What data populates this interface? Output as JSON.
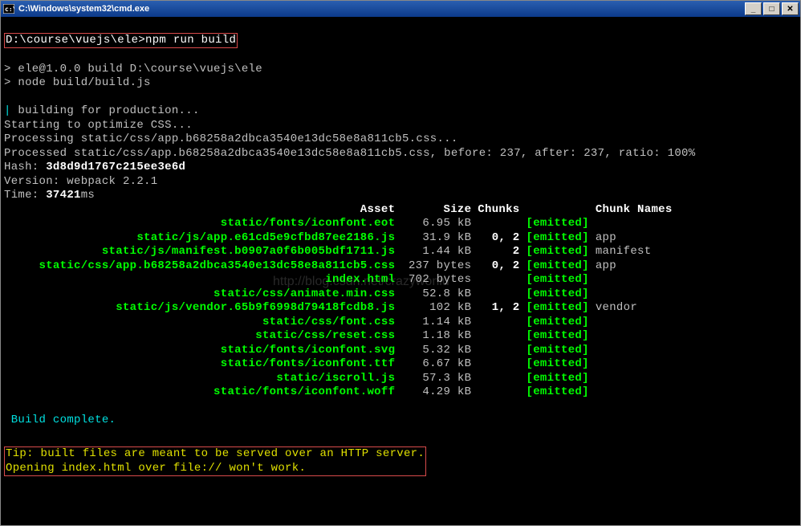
{
  "title": "C:\\Windows\\system32\\cmd.exe",
  "prompt": {
    "path": "D:\\course\\vuejs\\ele>",
    "cmd": "npm run build"
  },
  "npm_lines": [
    "> ele@1.0.0 build D:\\course\\vuejs\\ele",
    "> node build/build.js"
  ],
  "build": {
    "pipe": "|",
    "building": "building for production...",
    "optimize": "Starting to optimize CSS...",
    "processing": "Processing static/css/app.b68258a2dbca3540e13dc58e8a811cb5.css...",
    "processed_prefix": "Processed static/css/app.b68258a2dbca3540e13dc58e8a811cb5.css, before: 237, after: 237, ratio: 100%",
    "hash_label": "Hash: ",
    "hash_value": "3d8d9d1767c215ee3e6d",
    "version_label": "Version: webpack ",
    "version_value": "2.2.1",
    "time_label": "Time: ",
    "time_value": "37421",
    "time_unit": "ms",
    "complete": "Build complete."
  },
  "headers": {
    "asset": "Asset",
    "size": "Size",
    "chunks": "Chunks",
    "names": "Chunk Names"
  },
  "assets": [
    {
      "name": "static/fonts/iconfont.eot",
      "size": "6.95 kB",
      "chunks": "",
      "emitted": "[emitted]",
      "cname": ""
    },
    {
      "name": "static/js/app.e61cd5e9cfbd87ee2186.js",
      "size": "31.9 kB",
      "chunks": "0, 2",
      "emitted": "[emitted]",
      "cname": "app"
    },
    {
      "name": "static/js/manifest.b0907a0f6b005bdf1711.js",
      "size": "1.44 kB",
      "chunks": "2",
      "emitted": "[emitted]",
      "cname": "manifest"
    },
    {
      "name": "static/css/app.b68258a2dbca3540e13dc58e8a811cb5.css",
      "size": "237 bytes",
      "chunks": "0, 2",
      "emitted": "[emitted]",
      "cname": "app"
    },
    {
      "name": "index.html",
      "size": "702 bytes",
      "chunks": "",
      "emitted": "[emitted]",
      "cname": ""
    },
    {
      "name": "static/css/animate.min.css",
      "size": "52.8 kB",
      "chunks": "",
      "emitted": "[emitted]",
      "cname": ""
    },
    {
      "name": "static/js/vendor.65b9f6998d79418fcdb8.js",
      "size": "102 kB",
      "chunks": "1, 2",
      "emitted": "[emitted]",
      "cname": "vendor"
    },
    {
      "name": "static/css/font.css",
      "size": "1.14 kB",
      "chunks": "",
      "emitted": "[emitted]",
      "cname": ""
    },
    {
      "name": "static/css/reset.css",
      "size": "1.18 kB",
      "chunks": "",
      "emitted": "[emitted]",
      "cname": ""
    },
    {
      "name": "static/fonts/iconfont.svg",
      "size": "5.32 kB",
      "chunks": "",
      "emitted": "[emitted]",
      "cname": ""
    },
    {
      "name": "static/fonts/iconfont.ttf",
      "size": "6.67 kB",
      "chunks": "",
      "emitted": "[emitted]",
      "cname": ""
    },
    {
      "name": "static/iscroll.js",
      "size": "57.3 kB",
      "chunks": "",
      "emitted": "[emitted]",
      "cname": ""
    },
    {
      "name": "static/fonts/iconfont.woff",
      "size": "4.29 kB",
      "chunks": "",
      "emitted": "[emitted]",
      "cname": ""
    }
  ],
  "asset_col_width": 56,
  "tip": {
    "l1": "Tip: built files are meant to be served over an HTTP server.",
    "l2": "Opening index.html over file:// won't work."
  },
  "watermark": "http://blog.csdn.net/crazywoniu"
}
